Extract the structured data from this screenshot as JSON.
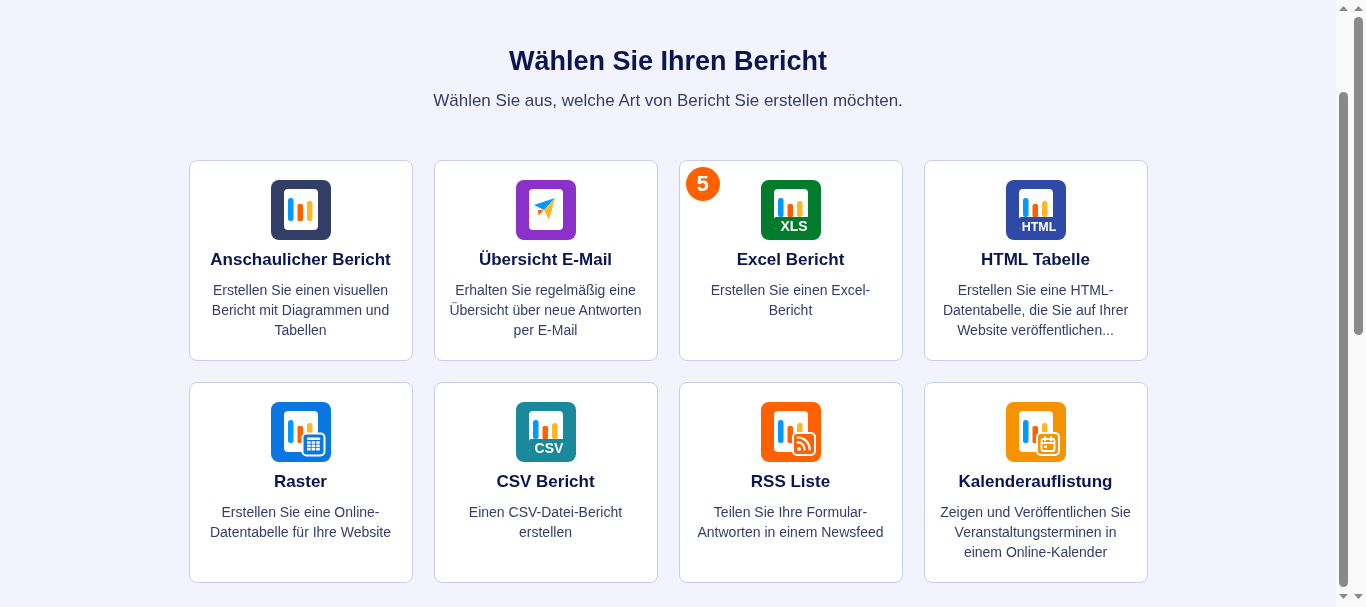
{
  "page": {
    "title": "Wählen Sie Ihren Bericht",
    "subtitle": "Wählen Sie aus, welche Art von Bericht Sie erstellen möchten."
  },
  "cards": [
    {
      "kind": "visual",
      "title": "Anschaulicher Bericht",
      "description": "Erstellen Sie einen visuellen Bericht mit Diagrammen und Tabellen"
    },
    {
      "kind": "email",
      "title": "Übersicht E-Mail",
      "description": "Erhalten Sie regelmäßig eine Übersicht über neue Antworten per E-Mail"
    },
    {
      "kind": "excel",
      "icon_label": "XLS",
      "badge": "5",
      "title": "Excel Bericht",
      "description": "Erstellen Sie einen Excel-Bericht"
    },
    {
      "kind": "html",
      "icon_label": "HTML",
      "title": "HTML Tabelle",
      "description": "Erstellen Sie eine HTML-Datentabelle, die Sie auf Ihrer Website veröffentlichen..."
    },
    {
      "kind": "grid",
      "title": "Raster",
      "description": "Erstellen Sie eine Online-Datentabelle für Ihre Website"
    },
    {
      "kind": "csv",
      "icon_label": "CSV",
      "title": "CSV Bericht",
      "description": "Einen CSV-Datei-Bericht erstellen"
    },
    {
      "kind": "rss",
      "title": "RSS Liste",
      "description": "Teilen Sie Ihre Formular-Antworten in einem Newsfeed"
    },
    {
      "kind": "calendar",
      "title": "Kalenderauflistung",
      "description": "Zeigen und Veröffentlichen Sie Veranstaltungsterminen in einem Online-Kalender"
    }
  ]
}
